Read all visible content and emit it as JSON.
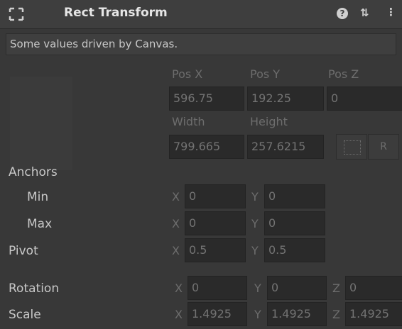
{
  "header": {
    "title": "Rect Transform",
    "help_icon": "?",
    "preset_icon": "⇅",
    "menu_icon": "⋮"
  },
  "notice": "Some values driven by Canvas.",
  "position": {
    "pos_x_label": "Pos X",
    "pos_y_label": "Pos Y",
    "pos_z_label": "Pos Z",
    "pos_x": "596.75",
    "pos_y": "192.25",
    "pos_z": "0"
  },
  "size": {
    "width_label": "Width",
    "height_label": "Height",
    "width": "799.665",
    "height": "257.6215",
    "raw_button": "R"
  },
  "anchors": {
    "label": "Anchors",
    "min_label": "Min",
    "max_label": "Max",
    "min_x": "0",
    "min_y": "0",
    "max_x": "0",
    "max_y": "0"
  },
  "pivot": {
    "label": "Pivot",
    "x": "0.5",
    "y": "0.5"
  },
  "rotation": {
    "label": "Rotation",
    "x": "0",
    "y": "0",
    "z": "0"
  },
  "scale": {
    "label": "Scale",
    "x": "1.4925",
    "y": "1.4925",
    "z": "1.4925"
  },
  "axes": {
    "x": "X",
    "y": "Y",
    "z": "Z"
  }
}
